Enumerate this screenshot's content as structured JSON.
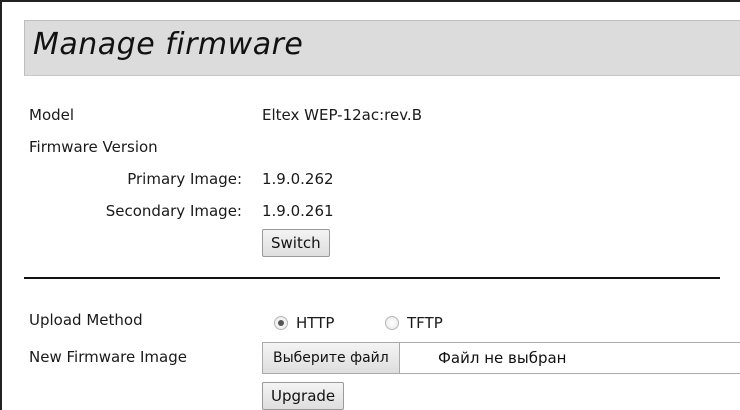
{
  "header": {
    "title": "Manage firmware"
  },
  "info": {
    "model_label": "Model",
    "model_value": "Eltex WEP-12ac:rev.B",
    "firmware_version_label": "Firmware Version",
    "primary_label": "Primary Image:",
    "primary_value": "1.9.0.262",
    "secondary_label": "Secondary Image:",
    "secondary_value": "1.9.0.261",
    "switch_label": "Switch"
  },
  "upload": {
    "method_label": "Upload Method",
    "options": [
      {
        "label": "HTTP",
        "selected": true
      },
      {
        "label": "TFTP",
        "selected": false
      }
    ],
    "new_image_label": "New Firmware Image",
    "choose_file_label": "Выберите файл",
    "no_file_label": "Файл не выбран",
    "upgrade_label": "Upgrade"
  }
}
